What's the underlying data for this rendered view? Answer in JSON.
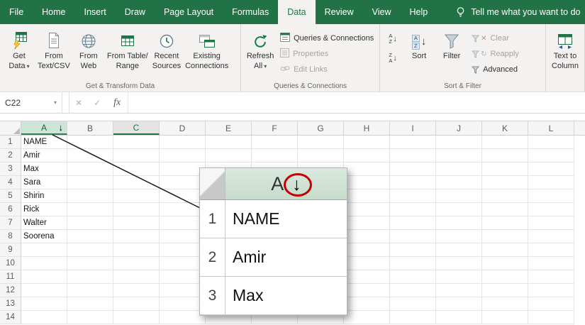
{
  "tabs": {
    "items": [
      {
        "label": "File"
      },
      {
        "label": "Home"
      },
      {
        "label": "Insert"
      },
      {
        "label": "Draw"
      },
      {
        "label": "Page Layout"
      },
      {
        "label": "Formulas"
      },
      {
        "label": "Data"
      },
      {
        "label": "Review"
      },
      {
        "label": "View"
      },
      {
        "label": "Help"
      }
    ],
    "active": "Data",
    "tell_me": "Tell me what you want to do"
  },
  "ribbon": {
    "get_transform": {
      "group_label": "Get & Transform Data",
      "get_data": {
        "line1": "Get",
        "line2": "Data"
      },
      "from_text_csv": {
        "line1": "From",
        "line2": "Text/CSV"
      },
      "from_web": {
        "line1": "From",
        "line2": "Web"
      },
      "from_table_range": {
        "line1": "From Table/",
        "line2": "Range"
      },
      "recent_sources": {
        "line1": "Recent",
        "line2": "Sources"
      },
      "existing_connections": {
        "line1": "Existing",
        "line2": "Connections"
      }
    },
    "queries_connections": {
      "group_label": "Queries & Connections",
      "refresh_all": {
        "line1": "Refresh",
        "line2": "All"
      },
      "queries_btn": "Queries & Connections",
      "properties_btn": "Properties",
      "edit_links_btn": "Edit Links"
    },
    "sort_filter": {
      "group_label": "Sort & Filter",
      "sort_btn": "Sort",
      "filter_btn": "Filter",
      "clear_btn": "Clear",
      "reapply_btn": "Reapply",
      "advanced_btn": "Advanced"
    },
    "data_tools": {
      "text_to_columns": {
        "line1": "Text to",
        "line2": "Column"
      }
    }
  },
  "formula_bar": {
    "name_box_value": "C22",
    "fx_label": "fx",
    "formula_value": ""
  },
  "grid": {
    "columns": [
      "A",
      "B",
      "C",
      "D",
      "E",
      "F",
      "G",
      "H",
      "I",
      "J",
      "K",
      "L"
    ],
    "selected_column": "A",
    "active_column": "C",
    "row_count": 14,
    "cells_column_a": {
      "1": "NAME",
      "2": "Amir",
      "3": "Max",
      "4": "Sara",
      "5": "Shirin",
      "6": "Rick",
      "7": "Walter",
      "8": "Soorena"
    }
  },
  "inset": {
    "column_header": "A",
    "rows": [
      {
        "num": "1",
        "value": "NAME"
      },
      {
        "num": "2",
        "value": "Amir"
      },
      {
        "num": "3",
        "value": "Max"
      }
    ]
  },
  "icons": {
    "caret_down": "▾",
    "down_arrow": "↓",
    "cancel": "✕",
    "check": "✓",
    "reapply_glyph": "↻",
    "letter_a": "A",
    "letter_z": "Z"
  },
  "colors": {
    "excel_green": "#217346",
    "annotation_red": "#c40000",
    "callout_line": "#1a1a1a"
  }
}
